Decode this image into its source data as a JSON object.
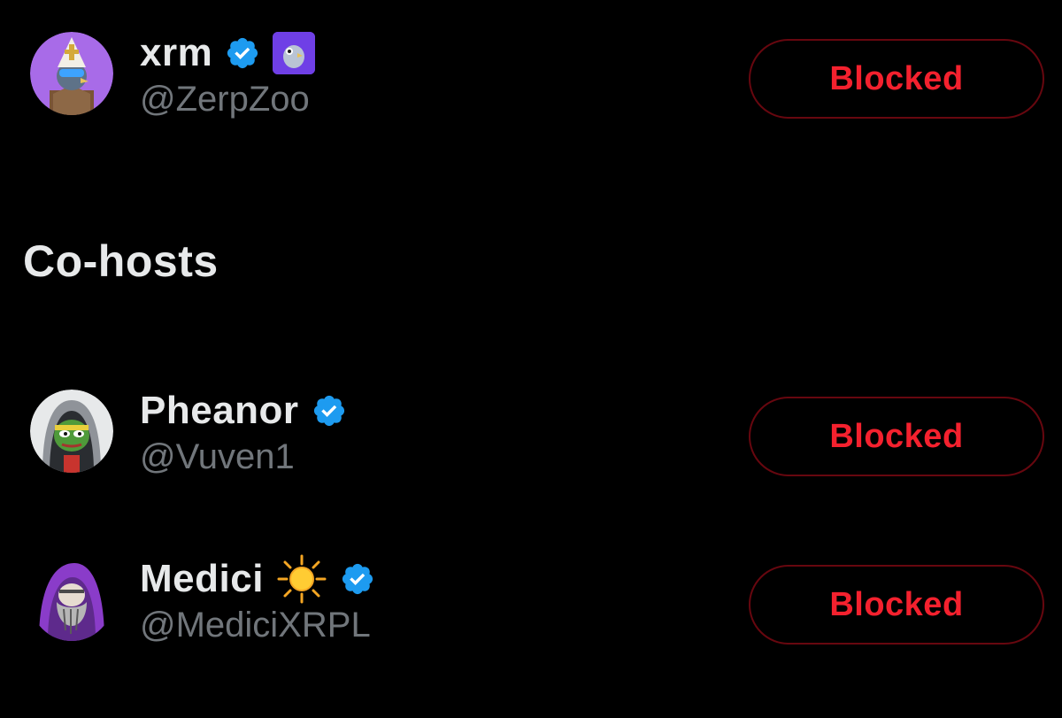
{
  "host": {
    "display_name": "xrm",
    "handle": "@ZerpZoo",
    "button_label": "Blocked",
    "verified_icon": "verified-badge-icon",
    "affiliate_badge_icon": "pigeon-affiliate-badge-icon"
  },
  "cohosts_section": {
    "title": "Co-hosts",
    "users": [
      {
        "display_name": "Pheanor",
        "handle": "@Vuven1",
        "button_label": "Blocked",
        "verified_icon": "verified-badge-icon"
      },
      {
        "display_name": "Medici",
        "handle": "@MediciXRPL",
        "button_label": "Blocked",
        "verified_icon": "verified-badge-icon",
        "emoji_icon": "sun-icon"
      }
    ]
  },
  "colors": {
    "background": "#000000",
    "name_text": "#e7e9ea",
    "handle_text": "#71767b",
    "blocked_red": "#f4212e",
    "blocked_border": "#67070f",
    "verified_blue": "#1d9bf0"
  }
}
